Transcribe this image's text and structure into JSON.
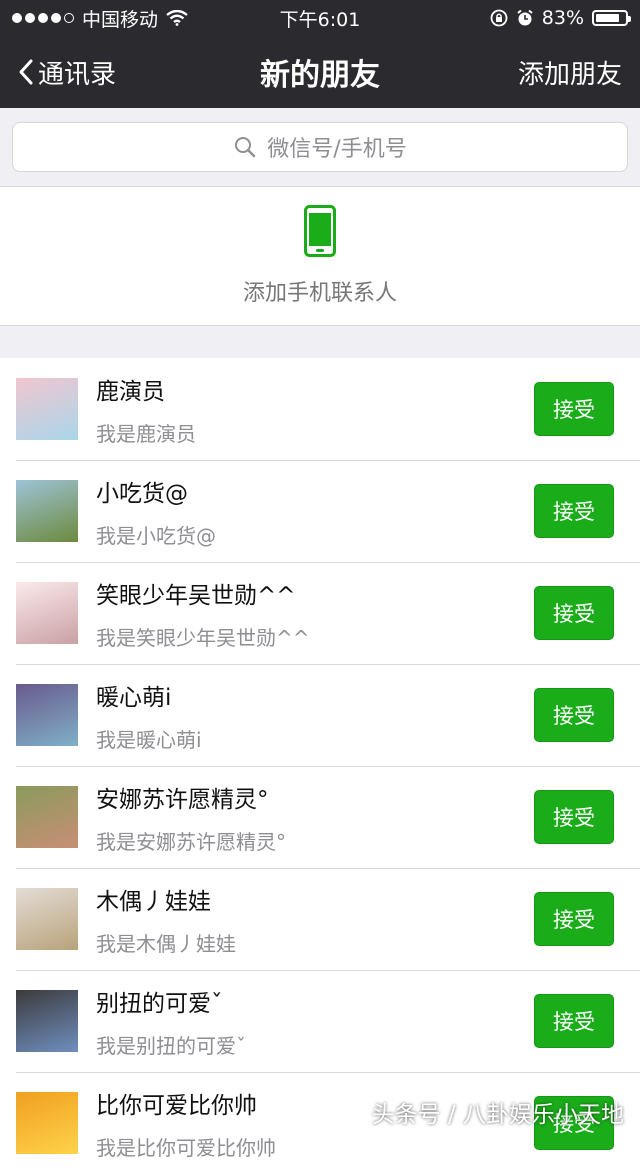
{
  "status_bar": {
    "carrier": "中国移动",
    "time": "下午6:01",
    "battery": "83%",
    "battery_level": 0.83
  },
  "nav": {
    "back_label": "通讯录",
    "title": "新的朋友",
    "right_label": "添加朋友"
  },
  "search": {
    "placeholder": "微信号/手机号"
  },
  "add_phone": {
    "label": "添加手机联系人",
    "icon": "phone-icon"
  },
  "friends": [
    {
      "name": "鹿演员",
      "message": "我是鹿演员",
      "button": "接受",
      "avatar_colors": [
        "#f1c6cf",
        "#a9d6ea"
      ]
    },
    {
      "name": "小吃货@",
      "message": "我是小吃货@",
      "button": "接受",
      "avatar_colors": [
        "#9ec3d8",
        "#6c8a3d"
      ]
    },
    {
      "name": "笑眼少年吴世勋^^",
      "message": "我是笑眼少年吴世勋^^",
      "button": "接受",
      "avatar_colors": [
        "#fbeaea",
        "#c9a0a6"
      ]
    },
    {
      "name": "暖心萌i",
      "message": "我是暖心萌i",
      "button": "接受",
      "avatar_colors": [
        "#6a5a8c",
        "#7fb0c8"
      ]
    },
    {
      "name": "安娜苏许愿精灵°",
      "message": "我是安娜苏许愿精灵°",
      "button": "接受",
      "avatar_colors": [
        "#8a9b5c",
        "#c98e76"
      ]
    },
    {
      "name": "木偶丿娃娃",
      "message": "我是木偶丿娃娃",
      "button": "接受",
      "avatar_colors": [
        "#e3ddd6",
        "#b9a27a"
      ]
    },
    {
      "name": "别扭的可爱ˇ",
      "message": "我是别扭的可爱ˇ",
      "button": "接受",
      "avatar_colors": [
        "#3c3a3c",
        "#6f8fbf"
      ]
    },
    {
      "name": "比你可爱比你帅",
      "message": "我是比你可爱比你帅",
      "button": "接受",
      "avatar_colors": [
        "#f0a020",
        "#ffd24a"
      ]
    }
  ],
  "watermark": "头条号 / 八卦娱乐小天地",
  "colors": {
    "accent": "#1aad19",
    "navbar": "#2b2b2f"
  }
}
